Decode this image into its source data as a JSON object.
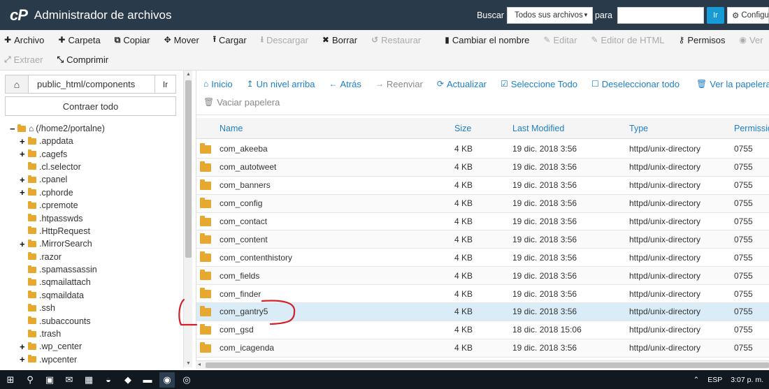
{
  "header": {
    "logo_text": "cP",
    "title": "Administrador de archivos",
    "search_label": "Buscar",
    "search_scope": "Todos sus archivos",
    "for_label": "para",
    "go_label": "Ir",
    "settings_label": "Configu"
  },
  "toolbar": {
    "row1": [
      {
        "label": "Archivo",
        "icon": "plus-icon",
        "glyph": "✚",
        "disabled": false
      },
      {
        "label": "Carpeta",
        "icon": "plus-icon",
        "glyph": "✚",
        "disabled": false
      },
      {
        "label": "Copiar",
        "icon": "copy-icon",
        "glyph": "⧉",
        "disabled": false
      },
      {
        "label": "Mover",
        "icon": "move-icon",
        "glyph": "✥",
        "disabled": false
      },
      {
        "label": "Cargar",
        "icon": "upload-icon",
        "glyph": "⭱",
        "disabled": false
      },
      {
        "label": "Descargar",
        "icon": "download-icon",
        "glyph": "⭳",
        "disabled": true
      },
      {
        "label": "Borrar",
        "icon": "delete-icon",
        "glyph": "✖",
        "disabled": false
      },
      {
        "label": "Restaurar",
        "icon": "restore-icon",
        "glyph": "↺",
        "disabled": true
      },
      {
        "label": "Cambiar el nombre",
        "icon": "rename-icon",
        "glyph": "▮",
        "disabled": false
      },
      {
        "label": "Editar",
        "icon": "edit-icon",
        "glyph": "✎",
        "disabled": true
      },
      {
        "label": "Editor de HTML",
        "icon": "html-editor-icon",
        "glyph": "✎",
        "disabled": true
      },
      {
        "label": "Permisos",
        "icon": "key-icon",
        "glyph": "⚷",
        "disabled": false
      },
      {
        "label": "Ver",
        "icon": "eye-icon",
        "glyph": "◉",
        "disabled": true
      }
    ],
    "row2": [
      {
        "label": "Extraer",
        "icon": "expand-icon",
        "glyph": "⤢",
        "disabled": true
      },
      {
        "label": "Comprimir",
        "icon": "compress-icon",
        "glyph": "⤡",
        "disabled": false
      }
    ]
  },
  "left_panel": {
    "path_value": "public_html/components",
    "go_label": "Ir",
    "collapse_label": "Contraer todo",
    "root_label": "(/home2/portalne)",
    "tree": [
      {
        "label": ".appdata",
        "expandable": true
      },
      {
        "label": ".cagefs",
        "expandable": true
      },
      {
        "label": ".cl.selector",
        "expandable": false
      },
      {
        "label": ".cpanel",
        "expandable": true
      },
      {
        "label": ".cphorde",
        "expandable": true
      },
      {
        "label": ".cpremote",
        "expandable": false
      },
      {
        "label": ".htpasswds",
        "expandable": false
      },
      {
        "label": ".HttpRequest",
        "expandable": false
      },
      {
        "label": ".MirrorSearch",
        "expandable": true
      },
      {
        "label": ".razor",
        "expandable": false
      },
      {
        "label": ".spamassassin",
        "expandable": false
      },
      {
        "label": ".sqmailattach",
        "expandable": false
      },
      {
        "label": ".sqmaildata",
        "expandable": false
      },
      {
        "label": ".ssh",
        "expandable": false
      },
      {
        "label": ".subaccounts",
        "expandable": false
      },
      {
        "label": ".trash",
        "expandable": false
      },
      {
        "label": ".wp_center",
        "expandable": true
      },
      {
        "label": ".wpcenter",
        "expandable": true
      }
    ]
  },
  "right_toolbar": {
    "row1": [
      {
        "label": "Inicio",
        "icon": "home-icon",
        "glyph": "⌂",
        "grey": false
      },
      {
        "label": "Un nivel arriba",
        "icon": "level-up-icon",
        "glyph": "↥",
        "grey": false
      },
      {
        "label": "Atrás",
        "icon": "back-arrow-icon",
        "glyph": "←",
        "grey": false
      },
      {
        "label": "Reenviar",
        "icon": "forward-arrow-icon",
        "glyph": "→",
        "grey": true
      },
      {
        "label": "Actualizar",
        "icon": "refresh-icon",
        "glyph": "⟳",
        "grey": false
      },
      {
        "label": "Seleccione Todo",
        "icon": "checkbox-checked-icon",
        "glyph": "☑",
        "grey": false
      },
      {
        "label": "Deseleccionar todo",
        "icon": "checkbox-empty-icon",
        "glyph": "☐",
        "grey": false
      },
      {
        "label": "Ver la papelera",
        "icon": "trash-icon",
        "glyph": "🗑",
        "grey": false
      }
    ],
    "row2": [
      {
        "label": "Vaciar papelera",
        "icon": "trash-icon",
        "glyph": "🗑",
        "grey": true
      }
    ]
  },
  "table": {
    "columns": {
      "name": "Name",
      "size": "Size",
      "modified": "Last Modified",
      "type": "Type",
      "perms": "Permissio"
    },
    "rows": [
      {
        "name": "com_akeeba",
        "size": "4 KB",
        "modified": "19 dic. 2018 3:56",
        "type": "httpd/unix-directory",
        "perms": "0755",
        "selected": false
      },
      {
        "name": "com_autotweet",
        "size": "4 KB",
        "modified": "19 dic. 2018 3:56",
        "type": "httpd/unix-directory",
        "perms": "0755",
        "selected": false
      },
      {
        "name": "com_banners",
        "size": "4 KB",
        "modified": "19 dic. 2018 3:56",
        "type": "httpd/unix-directory",
        "perms": "0755",
        "selected": false
      },
      {
        "name": "com_config",
        "size": "4 KB",
        "modified": "19 dic. 2018 3:56",
        "type": "httpd/unix-directory",
        "perms": "0755",
        "selected": false
      },
      {
        "name": "com_contact",
        "size": "4 KB",
        "modified": "19 dic. 2018 3:56",
        "type": "httpd/unix-directory",
        "perms": "0755",
        "selected": false
      },
      {
        "name": "com_content",
        "size": "4 KB",
        "modified": "19 dic. 2018 3:56",
        "type": "httpd/unix-directory",
        "perms": "0755",
        "selected": false
      },
      {
        "name": "com_contenthistory",
        "size": "4 KB",
        "modified": "19 dic. 2018 3:56",
        "type": "httpd/unix-directory",
        "perms": "0755",
        "selected": false
      },
      {
        "name": "com_fields",
        "size": "4 KB",
        "modified": "19 dic. 2018 3:56",
        "type": "httpd/unix-directory",
        "perms": "0755",
        "selected": false
      },
      {
        "name": "com_finder",
        "size": "4 KB",
        "modified": "19 dic. 2018 3:56",
        "type": "httpd/unix-directory",
        "perms": "0755",
        "selected": false
      },
      {
        "name": "com_gantry5",
        "size": "4 KB",
        "modified": "19 dic. 2018 3:56",
        "type": "httpd/unix-directory",
        "perms": "0755",
        "selected": true
      },
      {
        "name": "com_gsd",
        "size": "4 KB",
        "modified": "18 dic. 2018 15:06",
        "type": "httpd/unix-directory",
        "perms": "0755",
        "selected": false
      },
      {
        "name": "com_icagenda",
        "size": "4 KB",
        "modified": "19 dic. 2018 3:56",
        "type": "httpd/unix-directory",
        "perms": "0755",
        "selected": false
      }
    ]
  },
  "taskbar": {
    "lang": "ESP",
    "clock": "3:07 p. m."
  },
  "colors": {
    "header_bg": "#293a4a",
    "accent_blue": "#1e80c9",
    "folder": "#e6a82e",
    "selected_row": "#d9ecf7",
    "annotation_red": "#d0202a"
  }
}
